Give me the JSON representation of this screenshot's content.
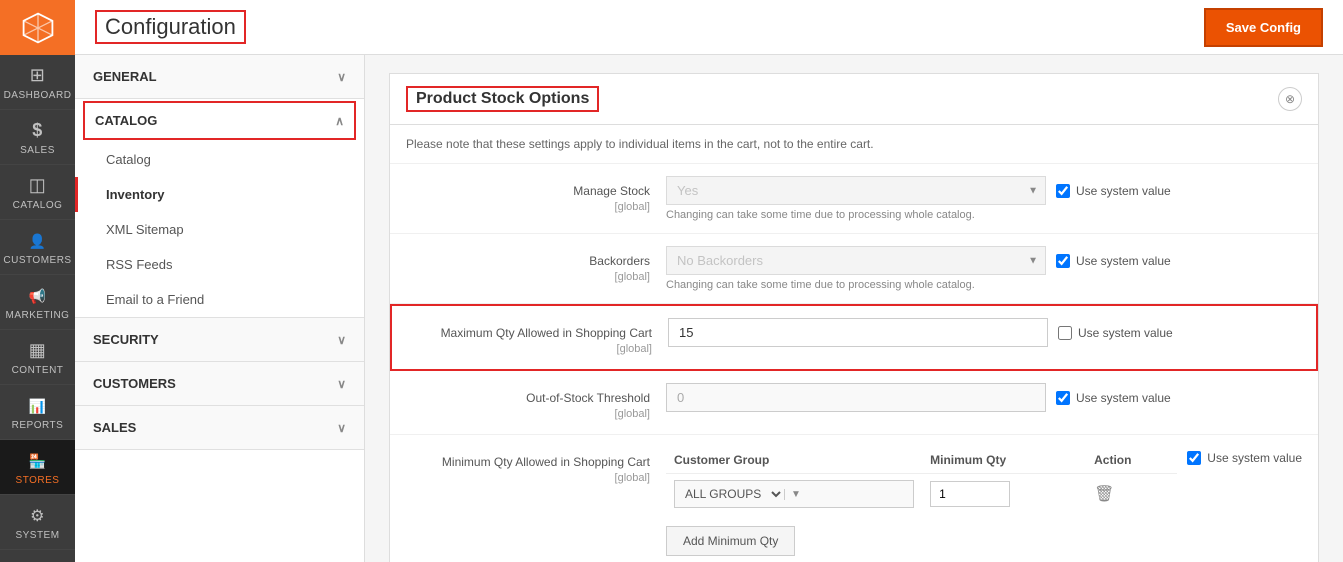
{
  "app": {
    "title": "Configuration",
    "save_btn": "Save Config"
  },
  "sidebar": {
    "items": [
      {
        "id": "dashboard",
        "label": "DASHBOARD",
        "icon": "dashboard",
        "active": false
      },
      {
        "id": "sales",
        "label": "SALES",
        "icon": "sales",
        "active": false
      },
      {
        "id": "catalog",
        "label": "CATALOG",
        "icon": "catalog",
        "active": false
      },
      {
        "id": "customers",
        "label": "CUSTOMERS",
        "icon": "customers",
        "active": false
      },
      {
        "id": "marketing",
        "label": "MARKETING",
        "icon": "marketing",
        "active": false
      },
      {
        "id": "content",
        "label": "CONTENT",
        "icon": "content",
        "active": false
      },
      {
        "id": "reports",
        "label": "REPORTS",
        "icon": "reports",
        "active": false
      },
      {
        "id": "stores",
        "label": "STORES",
        "icon": "stores",
        "active": true
      },
      {
        "id": "system",
        "label": "SYSTEM",
        "icon": "system",
        "active": false
      }
    ]
  },
  "left_menu": {
    "sections": [
      {
        "id": "general",
        "label": "GENERAL",
        "expanded": false,
        "arrow": "∨"
      },
      {
        "id": "catalog",
        "label": "CATALOG",
        "expanded": true,
        "arrow": "∧",
        "items": [
          {
            "id": "catalog",
            "label": "Catalog",
            "active": false
          },
          {
            "id": "inventory",
            "label": "Inventory",
            "active": true
          },
          {
            "id": "xml-sitemap",
            "label": "XML Sitemap",
            "active": false
          },
          {
            "id": "rss-feeds",
            "label": "RSS Feeds",
            "active": false
          },
          {
            "id": "email-friend",
            "label": "Email to a Friend",
            "active": false
          }
        ]
      },
      {
        "id": "security",
        "label": "SECURITY",
        "expanded": false,
        "arrow": "∨"
      },
      {
        "id": "customers",
        "label": "CUSTOMERS",
        "expanded": false,
        "arrow": "∨"
      },
      {
        "id": "sales-section",
        "label": "SALES",
        "expanded": false,
        "arrow": "∨"
      }
    ]
  },
  "main": {
    "section_title": "Product Stock Options",
    "note": "Please note that these settings apply to individual items in the cart, not to the entire cart.",
    "fields": {
      "manage_stock": {
        "label": "Manage Stock",
        "sublabel": "[global]",
        "value": "Yes",
        "hint": "Changing can take some time due to processing whole catalog.",
        "system_value": true,
        "system_value_label": "Use system value"
      },
      "backorders": {
        "label": "Backorders",
        "sublabel": "[global]",
        "value": "No Backorders",
        "hint": "Changing can take some time due to processing whole catalog.",
        "system_value": true,
        "system_value_label": "Use system value"
      },
      "max_qty": {
        "label": "Maximum Qty Allowed in Shopping Cart",
        "sublabel": "[global]",
        "value": "15",
        "system_value": false,
        "system_value_label": "Use system value"
      },
      "out_of_stock": {
        "label": "Out-of-Stock Threshold",
        "sublabel": "[global]",
        "value": "0",
        "system_value": true,
        "system_value_label": "Use system value"
      },
      "min_qty": {
        "label": "Minimum Qty Allowed in Shopping Cart",
        "sublabel": "[global]",
        "system_value": true,
        "system_value_label": "Use system value",
        "table": {
          "columns": [
            "Customer Group",
            "Minimum Qty",
            "Action"
          ],
          "rows": [
            {
              "group": "ALL GROUPS",
              "qty": "1"
            }
          ],
          "add_btn": "Add Minimum Qty"
        }
      }
    }
  }
}
